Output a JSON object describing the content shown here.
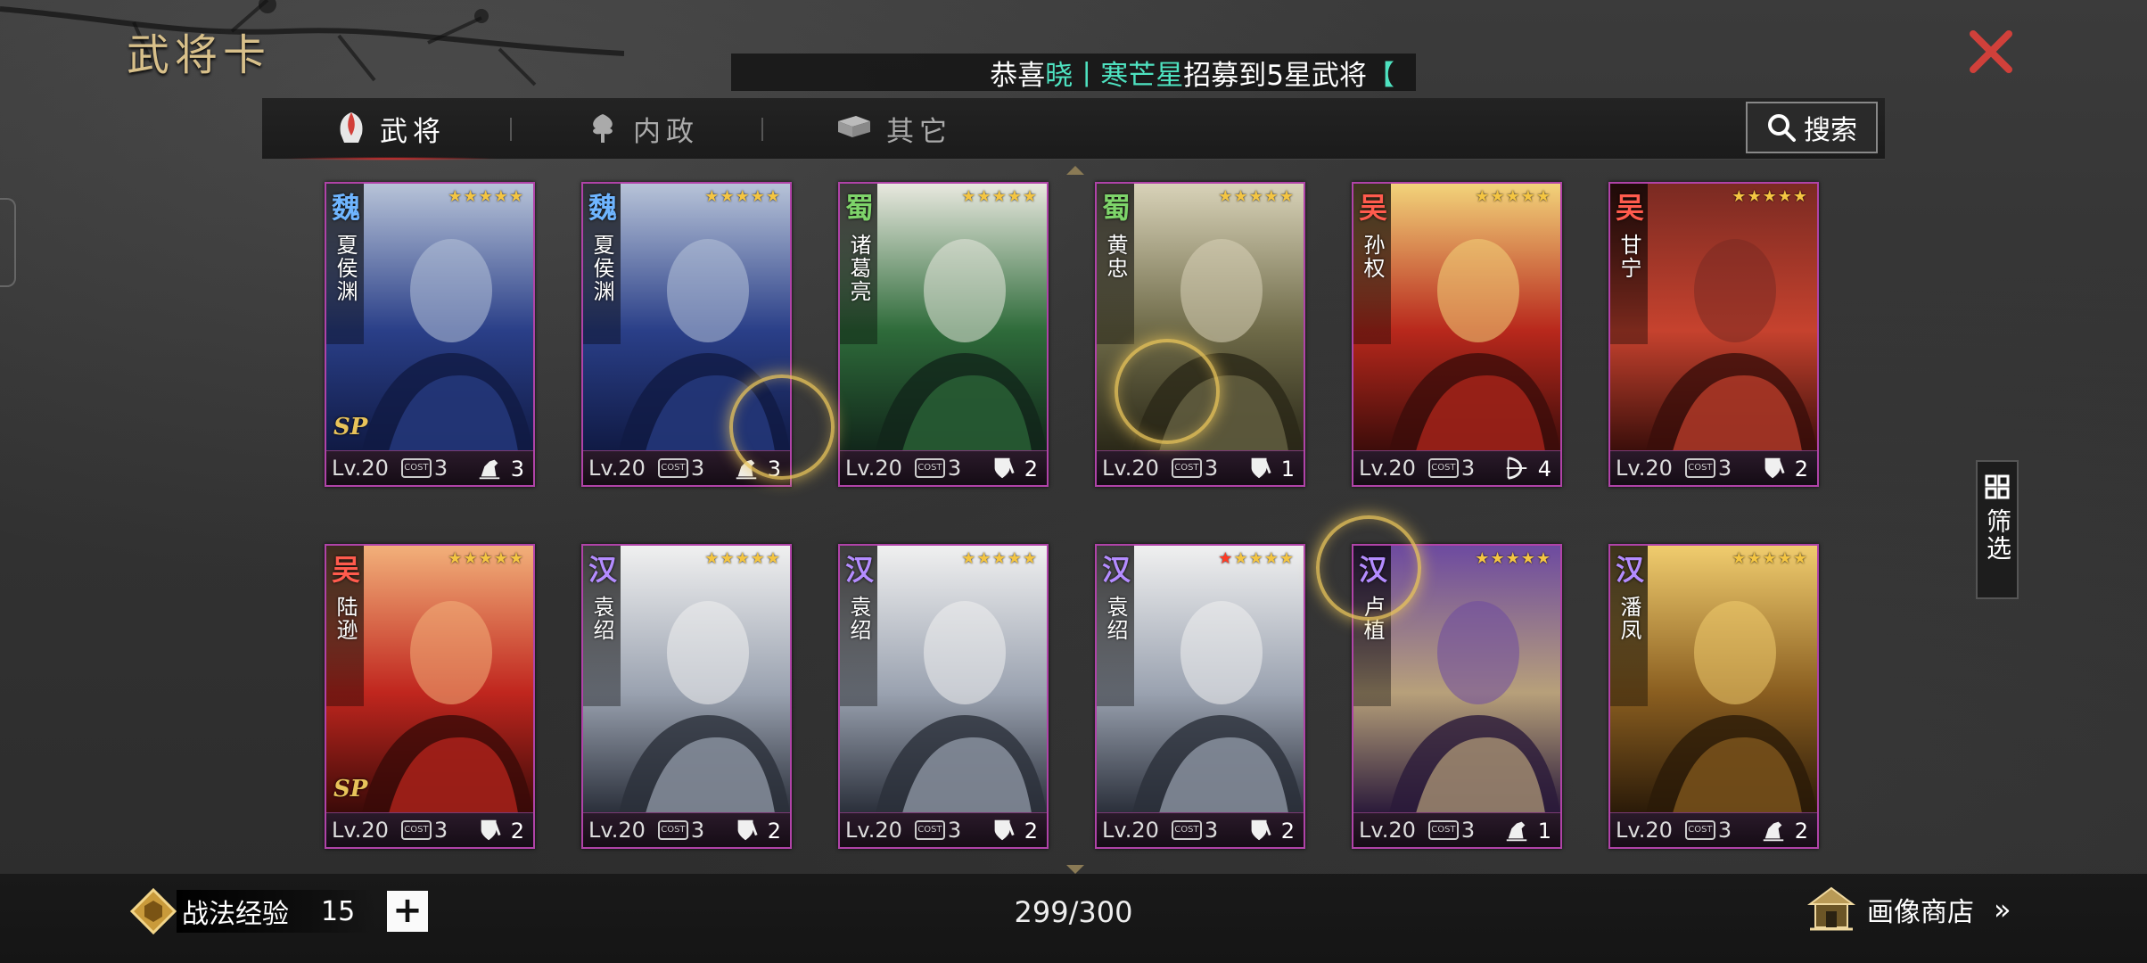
{
  "title": "武将卡",
  "marquee": {
    "prefix": "恭喜",
    "player": "晓丨寒芒星",
    "suffix": "招募到5星武将",
    "tail": "【"
  },
  "tabs": [
    {
      "label": "武将",
      "icon": "helmet-icon",
      "active": true
    },
    {
      "label": "内政",
      "icon": "tree-icon",
      "active": false
    },
    {
      "label": "其它",
      "icon": "book-icon",
      "active": false
    }
  ],
  "search_label": "搜索",
  "filter_label": "筛选",
  "cost_icon_text": "COST",
  "colors": {
    "card_border": "#b043a8",
    "wei": "#6fb5ff",
    "shu": "#7ed46a",
    "wu": "#ff5b4d",
    "han": "#b48cff",
    "star": "#f4c542",
    "marquee_highlight": "#4ee2c0"
  },
  "cards": [
    {
      "faction": "魏",
      "faction_key": "wei",
      "name": "夏侯渊",
      "stars": 5,
      "red_stars": 0,
      "level": "Lv.20",
      "cost": "3",
      "troop_icon": "cavalry-icon",
      "count": "3",
      "badge": "SP",
      "theme": "blue"
    },
    {
      "faction": "魏",
      "faction_key": "wei",
      "name": "夏侯渊",
      "stars": 5,
      "red_stars": 0,
      "level": "Lv.20",
      "cost": "3",
      "troop_icon": "cavalry-icon",
      "count": "3",
      "badge": "",
      "theme": "blue"
    },
    {
      "faction": "蜀",
      "faction_key": "shu",
      "name": "诸葛亮",
      "stars": 5,
      "red_stars": 0,
      "level": "Lv.20",
      "cost": "3",
      "troop_icon": "shield-icon",
      "count": "2",
      "badge": "",
      "theme": "green"
    },
    {
      "faction": "蜀",
      "faction_key": "shu",
      "name": "黄忠",
      "stars": 5,
      "red_stars": 0,
      "level": "Lv.20",
      "cost": "3",
      "troop_icon": "shield-icon",
      "count": "1",
      "badge": "",
      "theme": "olive"
    },
    {
      "faction": "吴",
      "faction_key": "wu",
      "name": "孙权",
      "stars": 5,
      "red_stars": 0,
      "level": "Lv.20",
      "cost": "3",
      "troop_icon": "bow-icon",
      "count": "4",
      "badge": "",
      "theme": "red"
    },
    {
      "faction": "吴",
      "faction_key": "wu",
      "name": "甘宁",
      "stars": 5,
      "red_stars": 0,
      "level": "Lv.20",
      "cost": "3",
      "troop_icon": "shield-icon",
      "count": "2",
      "badge": "",
      "theme": "crimson"
    },
    {
      "faction": "吴",
      "faction_key": "wu",
      "name": "陆逊",
      "stars": 5,
      "red_stars": 0,
      "level": "Lv.20",
      "cost": "3",
      "troop_icon": "shield-icon",
      "count": "2",
      "badge": "SP",
      "theme": "fire"
    },
    {
      "faction": "汉",
      "faction_key": "han",
      "name": "袁绍",
      "stars": 5,
      "red_stars": 0,
      "level": "Lv.20",
      "cost": "3",
      "troop_icon": "shield-icon",
      "count": "2",
      "badge": "",
      "theme": "steel"
    },
    {
      "faction": "汉",
      "faction_key": "han",
      "name": "袁绍",
      "stars": 5,
      "red_stars": 0,
      "level": "Lv.20",
      "cost": "3",
      "troop_icon": "shield-icon",
      "count": "2",
      "badge": "",
      "theme": "steel"
    },
    {
      "faction": "汉",
      "faction_key": "han",
      "name": "袁绍",
      "stars": 5,
      "red_stars": 1,
      "level": "Lv.20",
      "cost": "3",
      "troop_icon": "shield-icon",
      "count": "2",
      "badge": "",
      "theme": "steel"
    },
    {
      "faction": "汉",
      "faction_key": "han",
      "name": "卢植",
      "stars": 5,
      "red_stars": 0,
      "level": "Lv.20",
      "cost": "3",
      "troop_icon": "cavalry-icon",
      "count": "1",
      "badge": "",
      "theme": "purple"
    },
    {
      "faction": "汉",
      "faction_key": "han",
      "name": "潘凤",
      "stars": 5,
      "red_stars": 0,
      "level": "Lv.20",
      "cost": "3",
      "troop_icon": "cavalry-icon",
      "count": "2",
      "badge": "",
      "theme": "gold"
    }
  ],
  "footer": {
    "exp_label": "战法经验",
    "exp_value": "15",
    "plus_label": "+",
    "capacity": "299/300",
    "shop_label": "画像商店",
    "shop_chevron": "»"
  }
}
